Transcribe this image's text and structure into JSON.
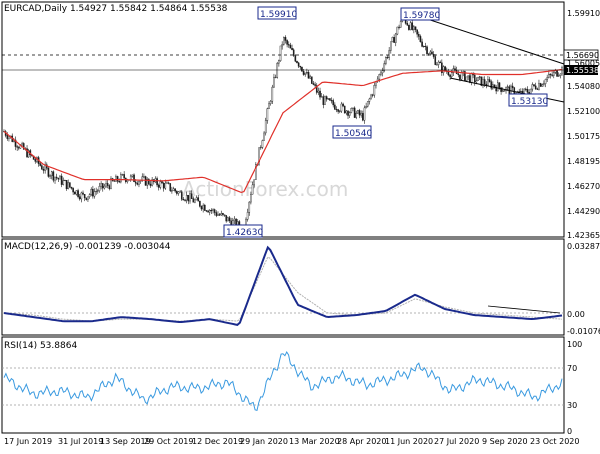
{
  "colors": {
    "background": "#ffffff",
    "frame": "#000000",
    "candle": "#1a1a1a",
    "ma": "#e0302a",
    "macd": "#1a2a8c",
    "signal": "#b0b0b0",
    "rsi": "#3a9ae0",
    "channel": "#000000",
    "dashed": "#000000",
    "watermark": "#d8d8d8",
    "label_bg": "#ffffff",
    "label_border": "#1a2a8c",
    "label_text": "#1a2a8c"
  },
  "panels": {
    "main": {
      "header": "EURCAD,Daily  1.54927 1.55842 1.54864 1.55538",
      "watermark": "ActionForex.com",
      "y_ticks": [
        "1.59910",
        "1.56005",
        "1.54080",
        "1.52100",
        "1.50175",
        "1.48195",
        "1.46270",
        "1.44290",
        "1.42365"
      ],
      "current_price": "1.55538",
      "dashed_level": "1.56690",
      "annotations": [
        "1.59910",
        "1.59780",
        "1.50540",
        "1.53130",
        "1.42630"
      ]
    },
    "macd": {
      "header": "MACD(12,26,9) -0.001239 -0.003044",
      "y_ticks": [
        "0.032871",
        "0.00",
        "-0.010762"
      ]
    },
    "rsi": {
      "header": "RSI(14) 53.8864",
      "y_ticks": [
        "100",
        "70",
        "30",
        "0"
      ]
    }
  },
  "x_ticks": [
    "17 Jun 2019",
    "31 Jul 2019",
    "13 Sep 2019",
    "29 Oct 2019",
    "12 Dec 2019",
    "29 Jan 2020",
    "13 Mar 2020",
    "28 Apr 2020",
    "11 Jun 2020",
    "27 Jul 2020",
    "9 Sep 2020",
    "23 Oct 2020"
  ],
  "chart_data": [
    {
      "type": "candlestick",
      "title": "EURCAD,Daily",
      "ylim": [
        1.42365,
        1.5991
      ],
      "ma_anchor": [
        1.505,
        1.478,
        1.466,
        1.466,
        1.465,
        1.468,
        1.455,
        1.52,
        1.545,
        1.542,
        1.552,
        1.554,
        1.551,
        1.551,
        1.555
      ],
      "close_anchor": [
        1.505,
        1.475,
        1.452,
        1.468,
        1.462,
        1.445,
        1.4263,
        1.58,
        1.53,
        1.517,
        1.5978,
        1.555,
        1.545,
        1.535,
        1.5554
      ],
      "annotations": [
        {
          "label": "1.59910",
          "value": 1.5991
        },
        {
          "label": "1.59780",
          "value": 1.5978
        },
        {
          "label": "1.50540",
          "value": 1.5054
        },
        {
          "label": "1.53130",
          "value": 1.5313
        },
        {
          "label": "1.42630",
          "value": 1.4263
        }
      ],
      "channel": {
        "upper": [
          1.5978,
          1.5602
        ],
        "lower": [
          1.541,
          1.5313
        ]
      },
      "current_price": 1.55538,
      "dashed_level": 1.5669
    },
    {
      "type": "line",
      "title": "MACD(12,26,9)",
      "ylim": [
        -0.010762,
        0.032871
      ],
      "macd": [
        0.0,
        -0.002,
        -0.004,
        -0.004,
        -0.002,
        -0.003,
        -0.0045,
        -0.003,
        -0.006,
        0.032871,
        0.004,
        -0.002,
        -0.001,
        0.001,
        0.009,
        0.002,
        -0.001,
        -0.002,
        -0.003,
        -0.001239
      ],
      "signal": [
        0.0,
        -0.001,
        -0.003,
        -0.004,
        -0.003,
        -0.003,
        -0.004,
        -0.003,
        -0.004,
        0.028,
        0.01,
        0.0,
        -0.001,
        0.0,
        0.007,
        0.003,
        0.0,
        -0.001,
        -0.002,
        -0.003044
      ],
      "current_macd": -0.001239,
      "current_signal": -0.003044
    },
    {
      "type": "line",
      "title": "RSI(14)",
      "ylim": [
        0,
        100
      ],
      "levels": [
        30,
        70
      ],
      "values": [
        60,
        42,
        45,
        38,
        60,
        35,
        50,
        48,
        55,
        25,
        88,
        50,
        62,
        52,
        60,
        72,
        45,
        58,
        50,
        38,
        53.8864
      ],
      "current": 53.8864
    }
  ]
}
